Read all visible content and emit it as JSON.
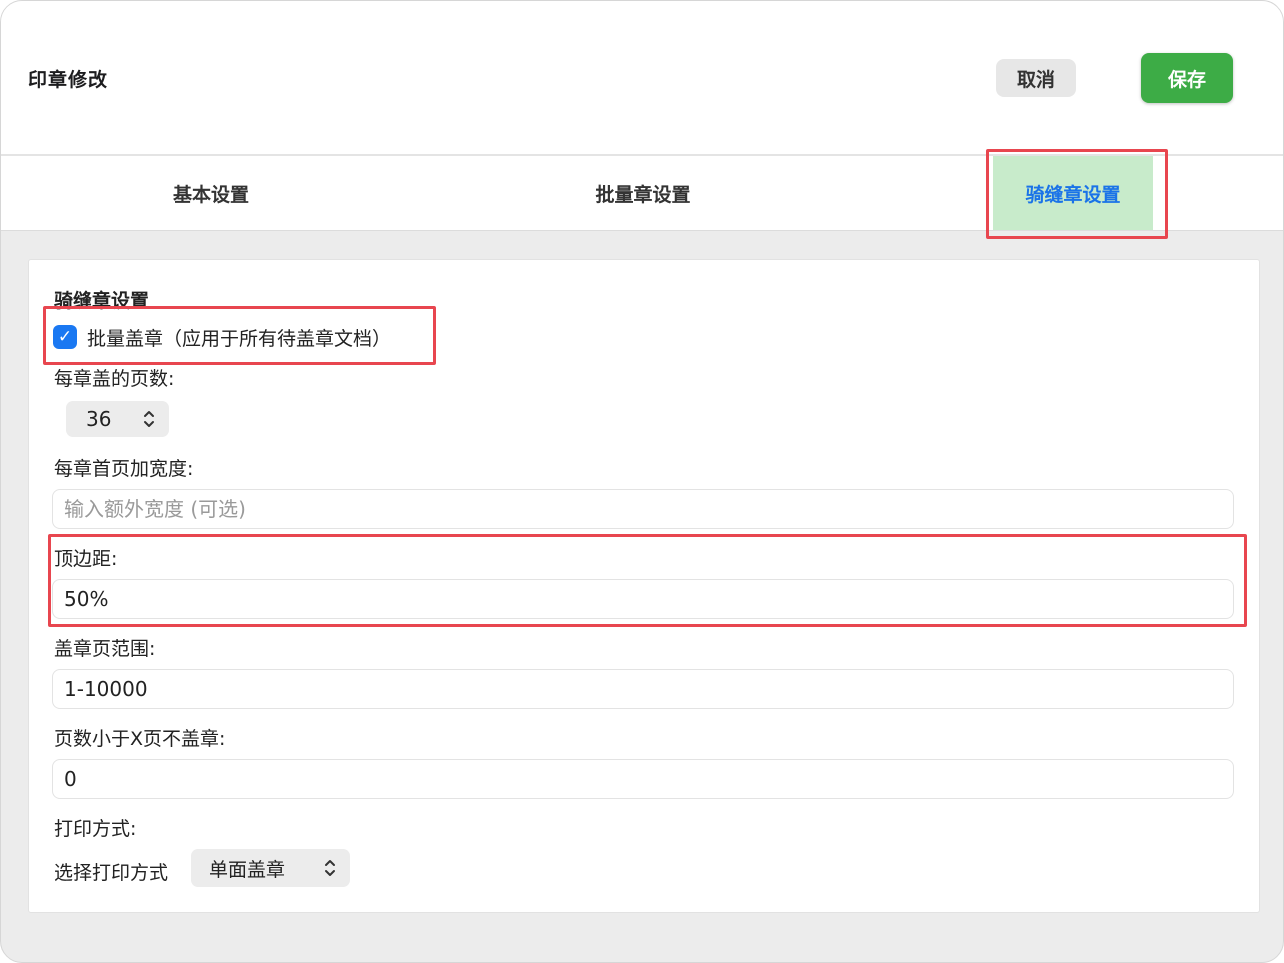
{
  "header": {
    "title": "印章修改",
    "cancel_label": "取消",
    "save_label": "保存"
  },
  "tabs": [
    {
      "label": "基本设置",
      "active": false
    },
    {
      "label": "批量章设置",
      "active": false
    },
    {
      "label": "骑缝章设置",
      "active": true
    }
  ],
  "form": {
    "section_title": "骑缝章设置",
    "batch_checkbox": {
      "label": "批量盖章（应用于所有待盖章文档）",
      "checked": true
    },
    "pages_per_seal": {
      "label": "每章盖的页数:",
      "value": "36"
    },
    "first_page_width": {
      "label": "每章首页加宽度:",
      "value": "",
      "placeholder": "输入额外宽度 (可选)"
    },
    "top_margin": {
      "label": "顶边距:",
      "value": "50%"
    },
    "page_range": {
      "label": "盖章页范围:",
      "value": "1-10000"
    },
    "min_pages": {
      "label": "页数小于X页不盖章:",
      "value": "0"
    },
    "print_mode": {
      "label": "打印方式:",
      "select_label": "选择打印方式",
      "value": "单面盖章"
    }
  },
  "colors": {
    "accent_blue": "#1a78f2",
    "save_green": "#3dac46",
    "active_tab_bg": "#c8ebcb",
    "highlight_red": "#e8464f"
  }
}
